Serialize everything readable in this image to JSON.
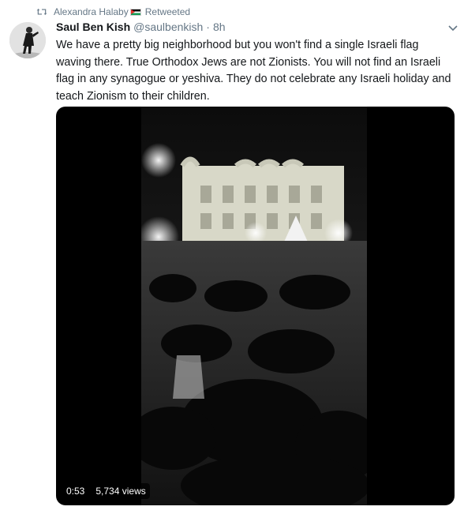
{
  "retweet_context": {
    "name": "Alexandra Halaby",
    "label": "Retweeted"
  },
  "tweet": {
    "display_name": "Saul Ben Kish",
    "handle": "@saulbenkish",
    "separator": "·",
    "time": "8h",
    "text": "We have a pretty big neighborhood  but you won't find a single Israeli flag waving there. True Orthodox Jews are not Zionists. You will not find an Israeli flag in any synagogue or yeshiva. They do not celebrate any Israeli holiday and teach Zionism to their children."
  },
  "video": {
    "duration": "0:53",
    "views": "5,734 views"
  },
  "icons": {
    "retweet": "retweet-icon",
    "flag": "palestinian-flag-icon",
    "caret": "chevron-down-icon"
  },
  "colors": {
    "secondary_text": "#657786",
    "primary_text": "#14171a",
    "video_background": "#000000"
  }
}
